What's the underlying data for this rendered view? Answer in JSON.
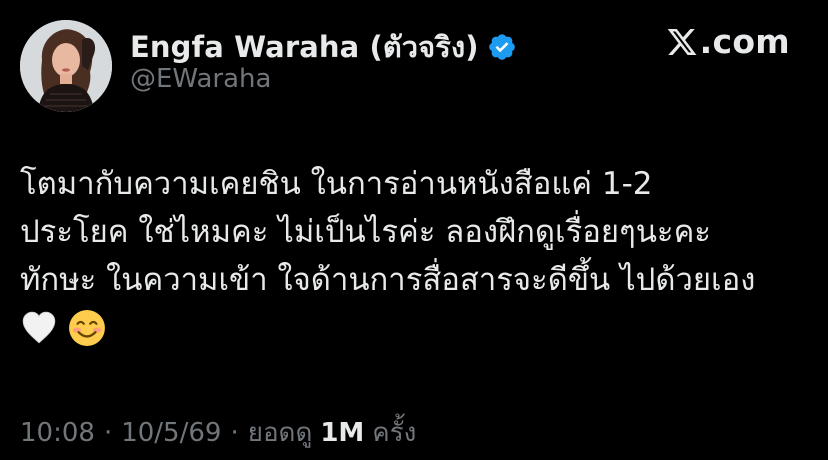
{
  "author": {
    "display_name": "Engfa Waraha (ตัวจริง)",
    "handle": "@EWaraha",
    "avatar_icon": "profile-photo",
    "verified_icon": "verified-badge-icon",
    "verified_color": "#1d9bf0"
  },
  "brand": {
    "logo_icon": "x-logo-icon",
    "text": ".com"
  },
  "tweet": {
    "lines": [
      "โตมากับความเคยชิน ในการอ่านหนังสือแค่ 1-2",
      "ประโยค ใช่ไหมคะ  ไม่เป็นไรค่ะ ลองฝึกดูเรื่อยๆนะคะ",
      "ทักษะ ในความเข้า ใจด้านการสื่อสารจะดีขึ้น ไปด้วยเอง"
    ],
    "emojis": [
      "white-heart-icon",
      "smiling-face-icon"
    ]
  },
  "meta": {
    "time": "10:08",
    "date": "10/5/69",
    "views_label": "ยอดดู",
    "views_count": "1M",
    "views_suffix": "ครั้ง",
    "separator": "·"
  },
  "colors": {
    "background": "#000000",
    "primary_text": "#e7e9ea",
    "secondary_text": "#71767b",
    "accent": "#1d9bf0"
  }
}
